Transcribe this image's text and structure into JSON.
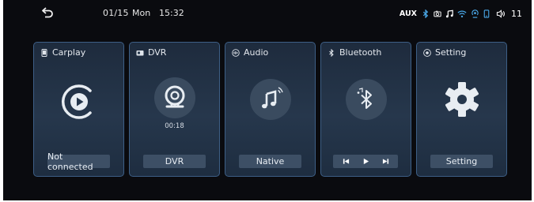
{
  "status": {
    "date": "01/15",
    "day": "Mon",
    "time": "15:32",
    "source": "AUX",
    "volume": "11",
    "icons": [
      "bluetooth-icon",
      "camera-icon",
      "music-icon",
      "wifi-icon",
      "hotspot-icon",
      "phone-icon",
      "volume-icon"
    ]
  },
  "cards": [
    {
      "title": "Carplay",
      "label": "Not connected",
      "icon": "carplay-play-icon"
    },
    {
      "title": "DVR",
      "label": "DVR",
      "sub": "00:18",
      "icon": "webcam-icon"
    },
    {
      "title": "Audio",
      "label": "Native",
      "icon": "music-note-icon"
    },
    {
      "title": "Bluetooth",
      "label": "",
      "icon": "bluetooth-music-icon"
    },
    {
      "title": "Setting",
      "label": "Setting",
      "icon": "gear-icon"
    }
  ],
  "colors": {
    "screen_bg": "#0a0b0f",
    "card_border": "#3d5f86",
    "card_bg": "#26374c",
    "label_bg": "#3d4f65",
    "accent": "#4aa8e8"
  }
}
